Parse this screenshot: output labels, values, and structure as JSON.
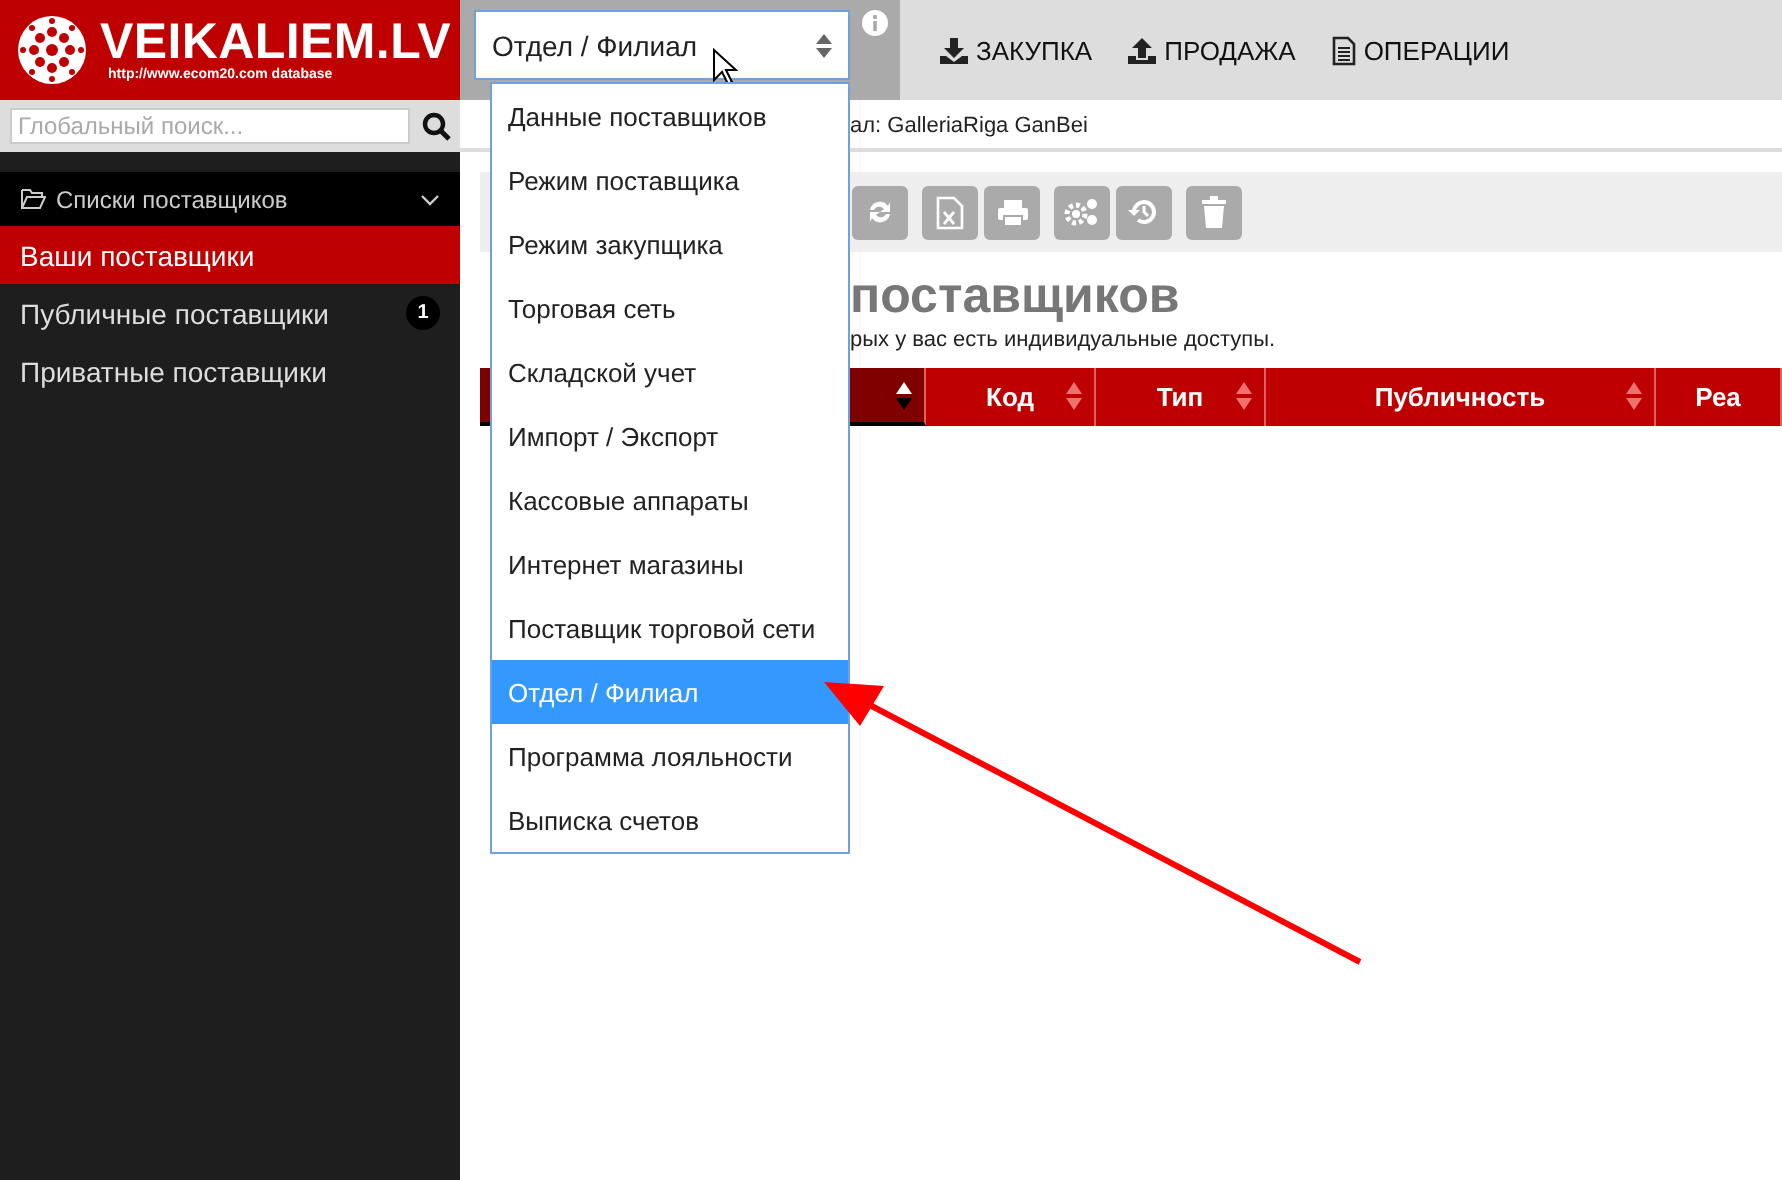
{
  "logo": {
    "title": "VEIKALIEM.LV",
    "subtitle": "http://www.ecom20.com database"
  },
  "topbar": {
    "select_value": "Отдел / Филиал",
    "nav": [
      {
        "label": "ЗАКУПКА"
      },
      {
        "label": "ПРОДАЖА"
      },
      {
        "label": "ОПЕРАЦИИ"
      }
    ]
  },
  "sidebar": {
    "search_placeholder": "Глобальный поиск...",
    "section": "Списки поставщиков",
    "items": [
      {
        "label": "Ваши поставщики",
        "selected": true
      },
      {
        "label": "Публичные поставщики",
        "selected": false,
        "badge": "1"
      },
      {
        "label": "Приватные поставщики",
        "selected": false
      }
    ]
  },
  "breadcrumb": "ал: GalleriaRiga GanBei",
  "heading": {
    "title": "поставщиков",
    "subtitle": "рых у вас есть индивидуальные доступы."
  },
  "table": {
    "columns": [
      {
        "sorted": true
      },
      {
        "label": "Код",
        "sorted": false
      },
      {
        "label": "Тип",
        "sorted": false
      },
      {
        "label": "Публичность",
        "sorted": false
      },
      {
        "label": "Реа",
        "sorted": false
      }
    ]
  },
  "dropdown": {
    "items": [
      {
        "label": "Данные поставщиков",
        "selected": false
      },
      {
        "label": "Режим поставщика",
        "selected": false
      },
      {
        "label": "Режим закупщика",
        "selected": false
      },
      {
        "label": "Торговая сеть",
        "selected": false
      },
      {
        "label": "Складской учет",
        "selected": false
      },
      {
        "label": "Импорт / Экспорт",
        "selected": false
      },
      {
        "label": "Кассовые аппараты",
        "selected": false
      },
      {
        "label": "Интернет магазины",
        "selected": false
      },
      {
        "label": "Поставщик торговой сети",
        "selected": false
      },
      {
        "label": "Отдел / Филиал",
        "selected": true
      },
      {
        "label": "Программа лояльности",
        "selected": false
      },
      {
        "label": "Выписка счетов",
        "selected": false
      }
    ]
  }
}
